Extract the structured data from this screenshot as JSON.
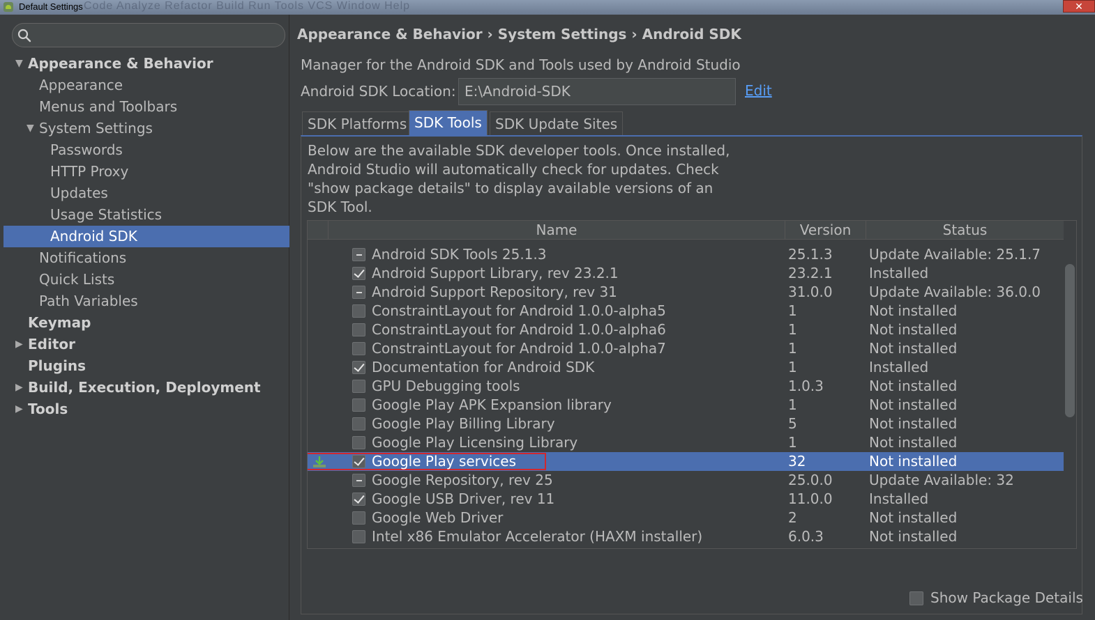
{
  "window": {
    "title": "Default Settings",
    "ghost_menu": "Code  Analyze  Refactor  Build  Run  Tools  VCS  Window  Help",
    "close_label": "✕"
  },
  "search": {
    "placeholder": "",
    "value": ""
  },
  "sidebar": {
    "items": [
      {
        "label": "Appearance & Behavior",
        "level": 0,
        "bold": true,
        "arrow": "▼"
      },
      {
        "label": "Appearance",
        "level": 1
      },
      {
        "label": "Menus and Toolbars",
        "level": 1
      },
      {
        "label": "System Settings",
        "level": 1,
        "arrow": "▼"
      },
      {
        "label": "Passwords",
        "level": 2
      },
      {
        "label": "HTTP Proxy",
        "level": 2
      },
      {
        "label": "Updates",
        "level": 2
      },
      {
        "label": "Usage Statistics",
        "level": 2
      },
      {
        "label": "Android SDK",
        "level": 2,
        "selected": true
      },
      {
        "label": "Notifications",
        "level": 1
      },
      {
        "label": "Quick Lists",
        "level": 1
      },
      {
        "label": "Path Variables",
        "level": 1
      },
      {
        "label": "Keymap",
        "level": 0,
        "bold": true
      },
      {
        "label": "Editor",
        "level": 0,
        "bold": true,
        "arrow": "▶"
      },
      {
        "label": "Plugins",
        "level": 0,
        "bold": true
      },
      {
        "label": "Build, Execution, Deployment",
        "level": 0,
        "bold": true,
        "arrow": "▶"
      },
      {
        "label": "Tools",
        "level": 0,
        "bold": true,
        "arrow": "▶"
      }
    ]
  },
  "main": {
    "breadcrumb": "Appearance & Behavior › System Settings › Android SDK",
    "description": "Manager for the Android SDK and Tools used by Android Studio",
    "sdk_location_label": "Android SDK Location:",
    "sdk_location_value": "E:\\Android-SDK",
    "edit_label": "Edit",
    "tabs": [
      {
        "label": "SDK Platforms",
        "active": false
      },
      {
        "label": "SDK Tools",
        "active": true
      },
      {
        "label": "SDK Update Sites",
        "active": false
      }
    ],
    "tab_description": "Below are the available SDK developer tools. Once installed, Android Studio will automatically check for updates. Check \"show package details\" to display available versions of an SDK Tool.",
    "table": {
      "columns": [
        "Name",
        "Version",
        "Status"
      ],
      "rows": [
        {
          "state": "partial",
          "name": "Android SDK Tools 25.1.3",
          "version": "25.1.3",
          "status": "Update Available: 25.1.7"
        },
        {
          "state": "checked",
          "name": "Android Support Library, rev 23.2.1",
          "version": "23.2.1",
          "status": "Installed"
        },
        {
          "state": "partial",
          "name": "Android Support Repository, rev 31",
          "version": "31.0.0",
          "status": "Update Available: 36.0.0"
        },
        {
          "state": "unchecked",
          "name": "ConstraintLayout for Android 1.0.0-alpha5",
          "version": "1",
          "status": "Not installed"
        },
        {
          "state": "unchecked",
          "name": "ConstraintLayout for Android 1.0.0-alpha6",
          "version": "1",
          "status": "Not installed"
        },
        {
          "state": "unchecked",
          "name": "ConstraintLayout for Android 1.0.0-alpha7",
          "version": "1",
          "status": "Not installed"
        },
        {
          "state": "checked",
          "name": "Documentation for Android SDK",
          "version": "1",
          "status": "Installed"
        },
        {
          "state": "unchecked",
          "name": "GPU Debugging tools",
          "version": "1.0.3",
          "status": "Not installed"
        },
        {
          "state": "unchecked",
          "name": "Google Play APK Expansion library",
          "version": "1",
          "status": "Not installed"
        },
        {
          "state": "unchecked",
          "name": "Google Play Billing Library",
          "version": "5",
          "status": "Not installed"
        },
        {
          "state": "unchecked",
          "name": "Google Play Licensing Library",
          "version": "1",
          "status": "Not installed"
        },
        {
          "state": "checked",
          "name": "Google Play services",
          "version": "32",
          "status": "Not installed",
          "selected": true,
          "download_icon": "download-icon"
        },
        {
          "state": "partial",
          "name": "Google Repository, rev 25",
          "version": "25.0.0",
          "status": "Update Available: 32"
        },
        {
          "state": "checked",
          "name": "Google USB Driver, rev 11",
          "version": "11.0.0",
          "status": "Installed"
        },
        {
          "state": "unchecked",
          "name": "Google Web Driver",
          "version": "2",
          "status": "Not installed"
        },
        {
          "state": "unchecked",
          "name": "Intel x86 Emulator Accelerator (HAXM installer)",
          "version": "6.0.3",
          "status": "Not installed"
        }
      ]
    },
    "show_package_details_label": "Show Package Details"
  },
  "colors": {
    "background": "#3c3f41",
    "selection": "#4b6eaf",
    "link": "#589df6",
    "highlight_box": "#d0282e"
  }
}
